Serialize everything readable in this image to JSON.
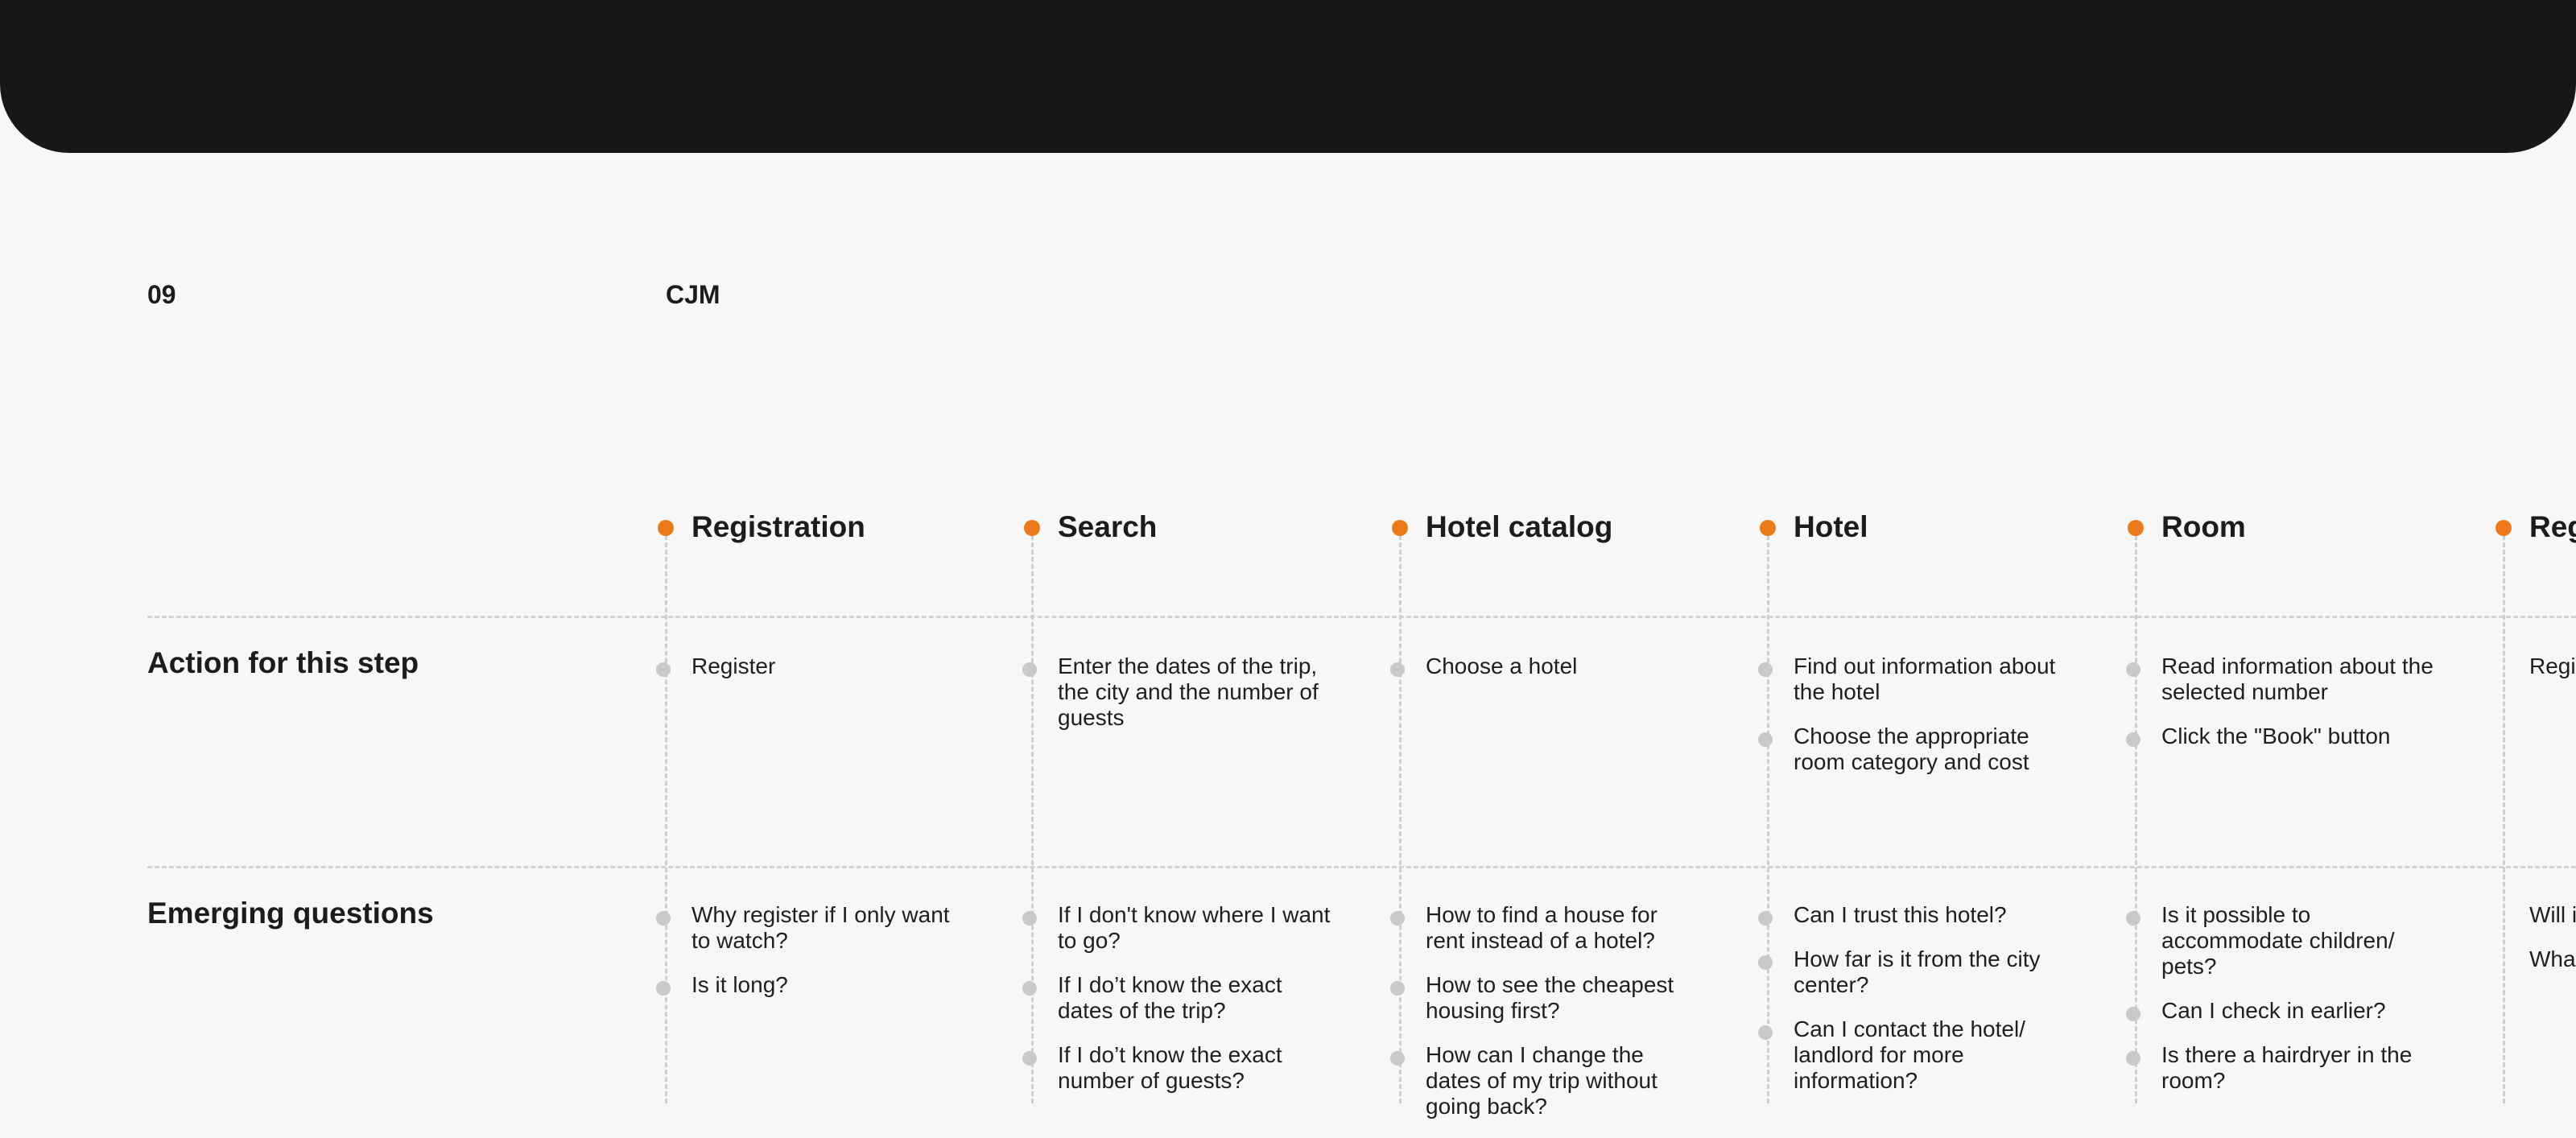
{
  "header": {
    "number": "09",
    "title": "CJM"
  },
  "stages": [
    {
      "title": "Registration",
      "actions": [
        "Register"
      ],
      "questions": [
        "Why register if I only want to watch?",
        "Is it long?"
      ]
    },
    {
      "title": "Search",
      "actions": [
        "Enter the dates of the trip, the city and the number of guests"
      ],
      "questions": [
        "If I don't know where I want to go?",
        "If I do’t know the exact dates of the trip?",
        "If I do’t know the exact number of guests?"
      ]
    },
    {
      "title": "Hotel catalog",
      "actions": [
        "Choose a hotel"
      ],
      "questions": [
        "How to find a house for rent instead of a hotel?",
        "How to see the cheapest housing first?",
        "How can I change the dates of my trip without going back?"
      ]
    },
    {
      "title": "Hotel",
      "actions": [
        "Find out information about the hotel",
        "Choose the appropriate room category and cost"
      ],
      "questions": [
        "Can I trust this hotel?",
        "How far is it from the city center?",
        "Can I contact the hotel/ landlord for more information?"
      ]
    },
    {
      "title": "Room",
      "actions": [
        "Read information about the selected number",
        "Click the \"Book\" button"
      ],
      "questions": [
        "Is it possible to accommodate children/ pets?",
        "Can I check in earlier?",
        "Is there a hairdryer in the room?"
      ]
    },
    {
      "title": "Reg",
      "actions": [
        "Regi"
      ],
      "questions": [
        "Will i",
        "Wha"
      ]
    }
  ],
  "rows": {
    "actions_label": "Action for this step",
    "questions_label": "Emerging questions"
  },
  "colors": {
    "background": "#f7f7f7",
    "top_bar": "#171719",
    "stage_dot": "#ec7a1d",
    "bullet": "#c9c9c9",
    "divider": "#d4d4d4"
  }
}
